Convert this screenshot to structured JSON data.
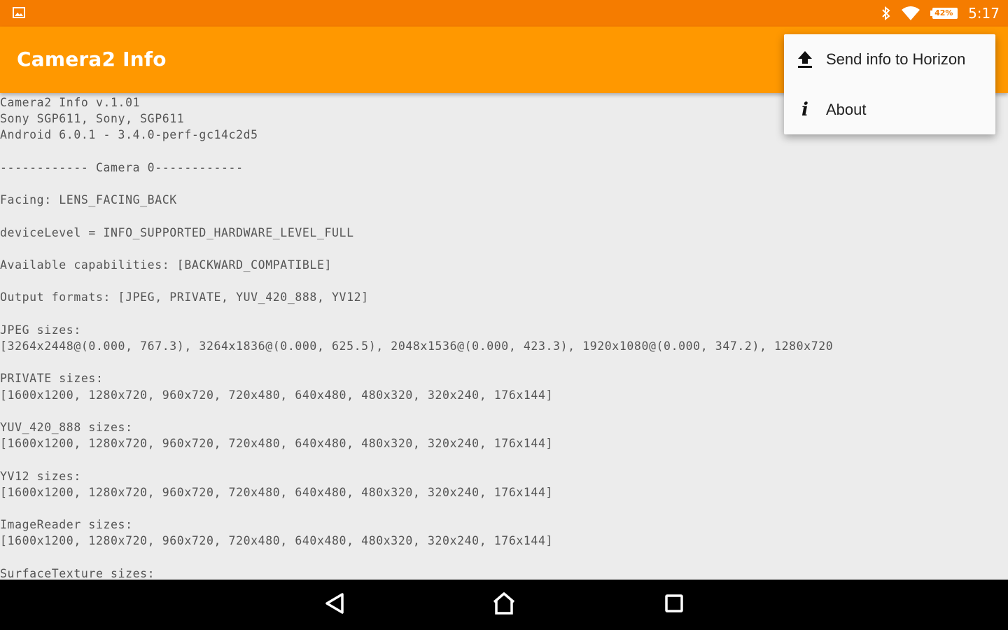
{
  "status_bar": {
    "left_icon": "image-icon",
    "icons": [
      "bluetooth-icon",
      "wifi-icon",
      "battery-icon"
    ],
    "battery_level": "42%",
    "time": "5:17"
  },
  "app_bar": {
    "title": "Camera2 Info"
  },
  "overflow_menu": {
    "items": [
      {
        "label": "Send info to Horizon",
        "icon": "upload-icon"
      },
      {
        "label": "About",
        "icon": "info-icon"
      }
    ]
  },
  "content": {
    "lines": [
      "Camera2 Info v.1.01",
      "Sony SGP611, Sony, SGP611",
      "Android 6.0.1 - 3.4.0-perf-gc14c2d5",
      "",
      "------------ Camera 0------------",
      "",
      "Facing: LENS_FACING_BACK",
      "",
      "deviceLevel = INFO_SUPPORTED_HARDWARE_LEVEL_FULL",
      "",
      "Available capabilities: [BACKWARD_COMPATIBLE]",
      "",
      "Output formats: [JPEG, PRIVATE, YUV_420_888, YV12]",
      "",
      "JPEG sizes:",
      "[3264x2448@(0.000, 767.3), 3264x1836@(0.000, 625.5), 2048x1536@(0.000, 423.3), 1920x1080@(0.000, 347.2), 1280x720",
      "",
      "PRIVATE sizes:",
      "[1600x1200, 1280x720, 960x720, 720x480, 640x480, 480x320, 320x240, 176x144]",
      "",
      "YUV_420_888 sizes:",
      "[1600x1200, 1280x720, 960x720, 720x480, 640x480, 480x320, 320x240, 176x144]",
      "",
      "YV12 sizes:",
      "[1600x1200, 1280x720, 960x720, 720x480, 640x480, 480x320, 320x240, 176x144]",
      "",
      "ImageReader sizes:",
      "[1600x1200, 1280x720, 960x720, 720x480, 640x480, 480x320, 320x240, 176x144]",
      "",
      "SurfaceTexture sizes:"
    ]
  },
  "nav_bar": {
    "buttons": [
      "back-icon",
      "home-icon",
      "recents-icon"
    ]
  },
  "colors": {
    "status_bar": "#f57c00",
    "app_bar": "#ff9800",
    "background": "#ececec",
    "text": "#555555"
  }
}
